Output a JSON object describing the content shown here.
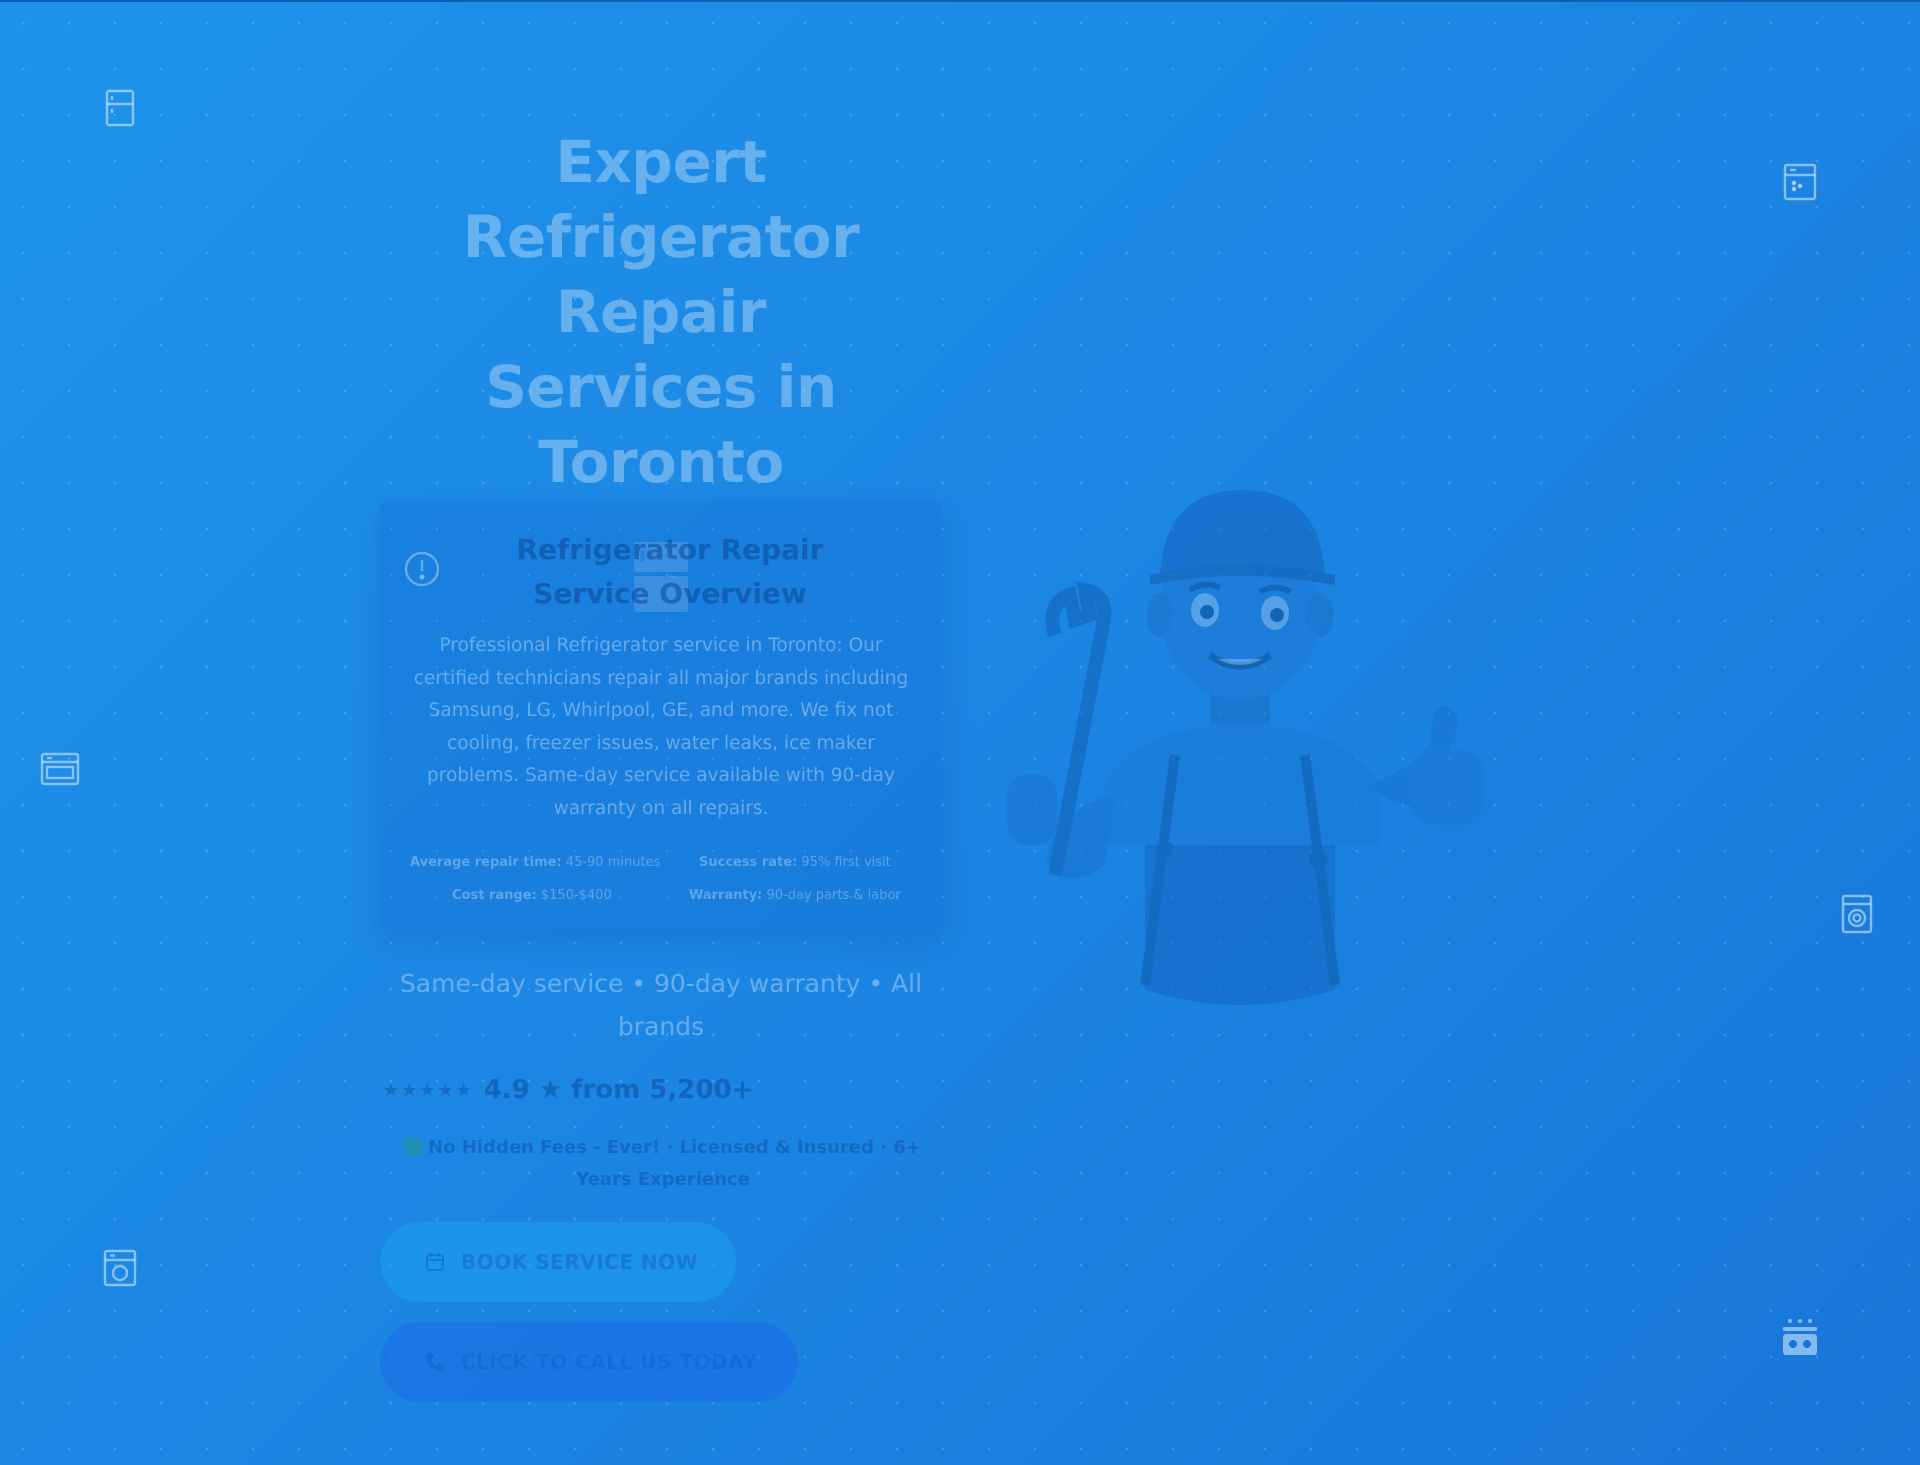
{
  "hero": {
    "title_line1": "Expert",
    "title_line2": "Refrigerator Repair",
    "title_line3": "Services in Toronto",
    "title_icon": "refrigerator-icon"
  },
  "overview": {
    "icon": "alert-circle-icon",
    "title": "Refrigerator Repair Service Overview",
    "body": "Professional Refrigerator service in Toronto: Our certified technicians repair all major brands including Samsung, LG, Whirlpool, GE, and more. We fix not cooling, freezer issues, water leaks, ice maker problems. Same-day service available with 90-day warranty on all repairs.",
    "stats": {
      "avg_label": "Average repair time:",
      "avg_value": "45-90 minutes",
      "success_label": "Success rate:",
      "success_value": "95% first visit",
      "cost_label": "Cost range:",
      "cost_value": "$150-$400",
      "warranty_label": "Warranty:",
      "warranty_value": "90-day parts & labor"
    }
  },
  "subtext": "Same-day service • 90-day warranty • All brands",
  "rating": {
    "stars": "★★★★★",
    "text": "4.9 ★ from 5,200+"
  },
  "trust": "No Hidden Fees - Ever! · Licensed & Insured · 6+ Years Experience",
  "buttons": {
    "book_label": "BOOK SERVICE NOW",
    "book_icon": "calendar-icon",
    "call_label": "CLICK TO CALL US TODAY",
    "call_icon": "phone-icon"
  },
  "background_icons": [
    "refrigerator-icon",
    "dishwasher-icon",
    "oven-icon",
    "washer-icon",
    "dryer-icon",
    "cooktop-icon"
  ],
  "colors": {
    "background": "#1c87e4",
    "accent": "#1f93ea"
  }
}
